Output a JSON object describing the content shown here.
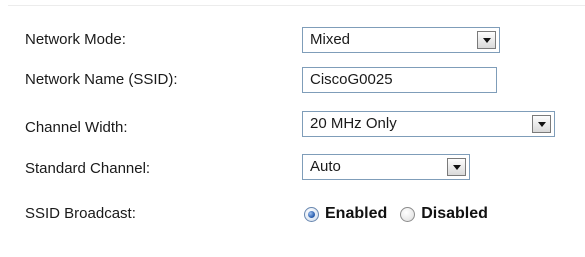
{
  "form": {
    "network_mode": {
      "label": "Network Mode:",
      "value": "Mixed"
    },
    "network_name": {
      "label": "Network Name (SSID):",
      "value": "CiscoG0025"
    },
    "channel_width": {
      "label": "Channel Width:",
      "value": "20 MHz Only"
    },
    "standard_channel": {
      "label": "Standard Channel:",
      "value": "Auto"
    },
    "ssid_broadcast": {
      "label": "SSID Broadcast:",
      "options": [
        {
          "label": "Enabled",
          "checked": true
        },
        {
          "label": "Disabled",
          "checked": false
        }
      ]
    }
  },
  "colors": {
    "field_border": "#7f9db9",
    "radio_checked": "#2f63b3"
  },
  "icons": {
    "dropdown": "chevron-down-icon"
  }
}
